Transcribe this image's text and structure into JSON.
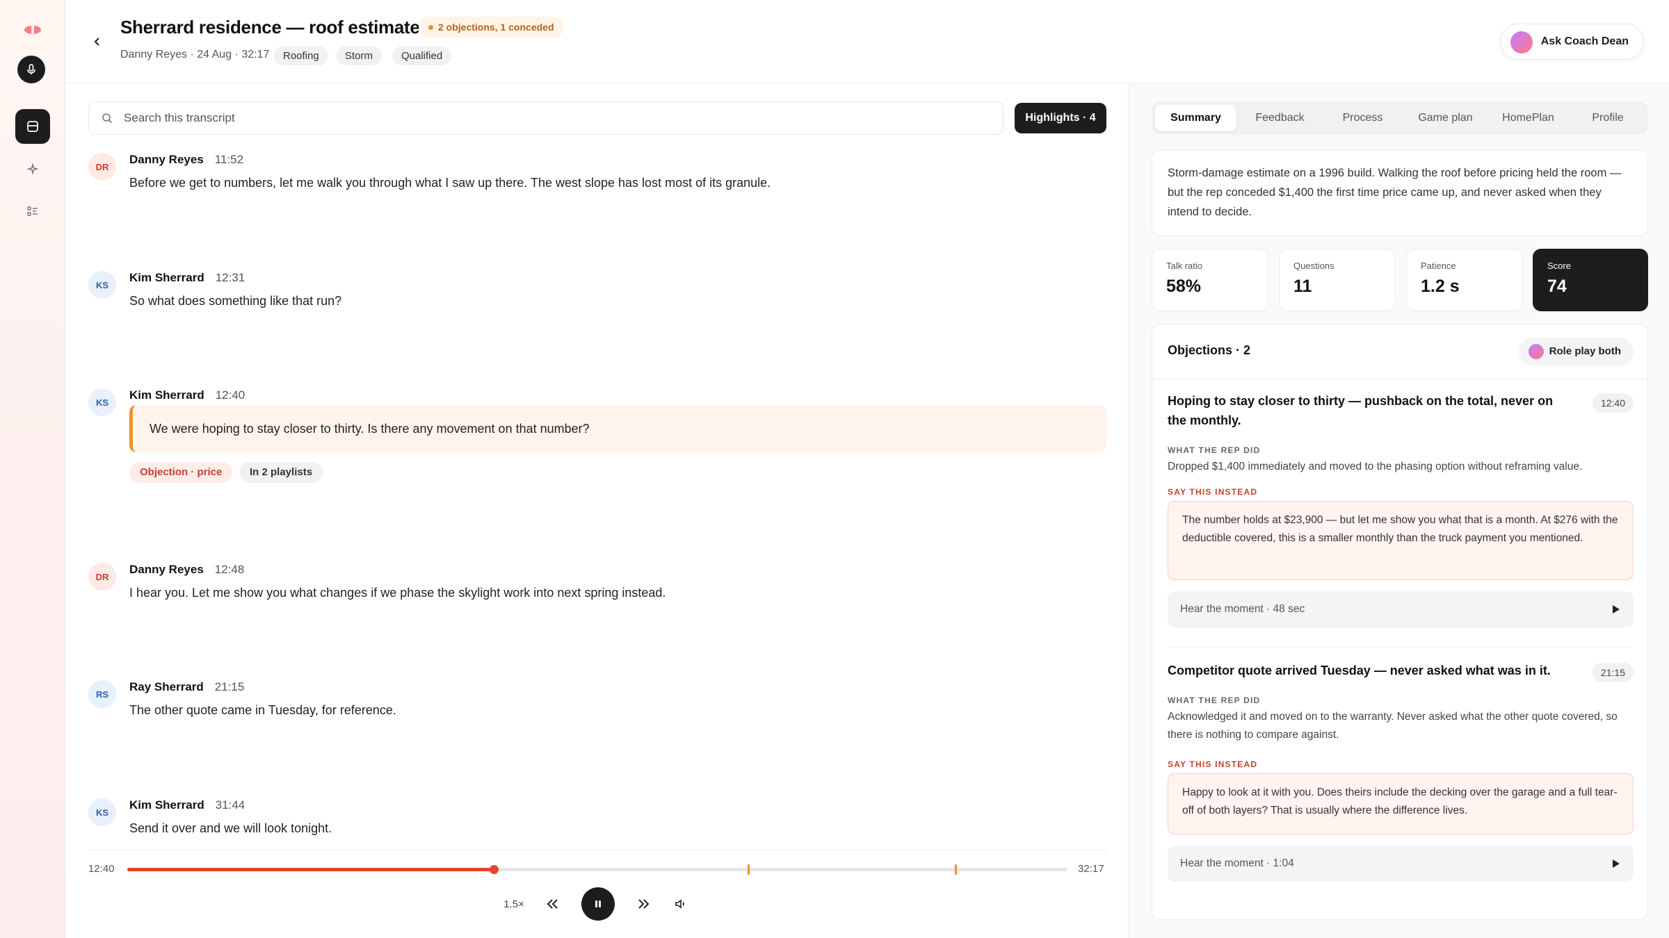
{
  "header": {
    "title": "Sherrard residence — roof estimate",
    "objection_badge": "2 objections, 1 conceded",
    "meta": "Danny Reyes · 24 Aug · 32:17",
    "tags": [
      "Roofing",
      "Storm",
      "Qualified"
    ],
    "coach_button": "Ask Coach Dean"
  },
  "transcript": {
    "search_placeholder": "Search this transcript",
    "highlights_label": "Highlights · 4",
    "messages": [
      {
        "initials": "DR",
        "speaker": "Danny Reyes",
        "time": "11:52",
        "text": "Before we get to numbers, let me walk you through what I saw up there. The west slope has lost most of its granule."
      },
      {
        "initials": "KS",
        "speaker": "Kim Sherrard",
        "time": "12:31",
        "text": "So what does something like that run?"
      },
      {
        "initials": "KS",
        "speaker": "Kim Sherrard",
        "time": "12:40",
        "text": "We were hoping to stay closer to thirty. Is there any movement on that number?",
        "chips": [
          "Objection · price",
          "In 2 playlists"
        ]
      },
      {
        "initials": "DR",
        "speaker": "Danny Reyes",
        "time": "12:48",
        "text": "I hear you. Let me show you what changes if we phase the skylight work into next spring instead."
      },
      {
        "initials": "RS",
        "speaker": "Ray Sherrard",
        "time": "21:15",
        "text": "The other quote came in Tuesday, for reference."
      },
      {
        "initials": "KS",
        "speaker": "Kim Sherrard",
        "time": "31:44",
        "text": "Send it over and we will look tonight."
      }
    ]
  },
  "player": {
    "current_time": "12:40",
    "total_time": "32:17",
    "progress": 0.39,
    "markers": [
      0.66,
      0.88
    ],
    "speed": "1.5×"
  },
  "tabs": [
    "Summary",
    "Feedback",
    "Process",
    "Game plan",
    "HomePlan",
    "Profile"
  ],
  "summary_text": "Storm-damage estimate on a 1996 build. Walking the roof before pricing held the room — but the rep conceded $1,400 the first time price came up, and never asked when they intend to decide.",
  "stats": [
    {
      "label": "Talk ratio",
      "value": "58%"
    },
    {
      "label": "Questions",
      "value": "11"
    },
    {
      "label": "Patience",
      "value": "1.2 s"
    },
    {
      "label": "Score",
      "value": "74"
    }
  ],
  "objections": {
    "title": "Objections · 2",
    "roleplay_label": "Role play both",
    "labels": {
      "did": "WHAT THE REP DID",
      "instead": "SAY THIS INSTEAD"
    },
    "items": [
      {
        "headline": "Hoping to stay closer to thirty — pushback on the total, never on the monthly.",
        "time": "12:40",
        "did": "Dropped $1,400 immediately and moved to the phasing option without reframing value.",
        "instead": "The number holds at $23,900 — but let me show you what that is a month. At $276 with the deductible covered, this is a smaller monthly than the truck payment you mentioned.",
        "hear": "Hear the moment · 48 sec"
      },
      {
        "headline": "Competitor quote arrived Tuesday — never asked what was in it.",
        "time": "21:15",
        "did": "Acknowledged it and moved on to the warranty. Never asked what the other quote covered, so there is nothing to compare against.",
        "instead": "Happy to look at it with you. Does theirs include the decking over the garage and a full tear-off of both layers? That is usually where the difference lives.",
        "hear": "Hear the moment · 1:04"
      }
    ]
  },
  "colors": {
    "accent": "#e4432d",
    "warning": "#e8932e",
    "dark": "#1d1d1f"
  }
}
